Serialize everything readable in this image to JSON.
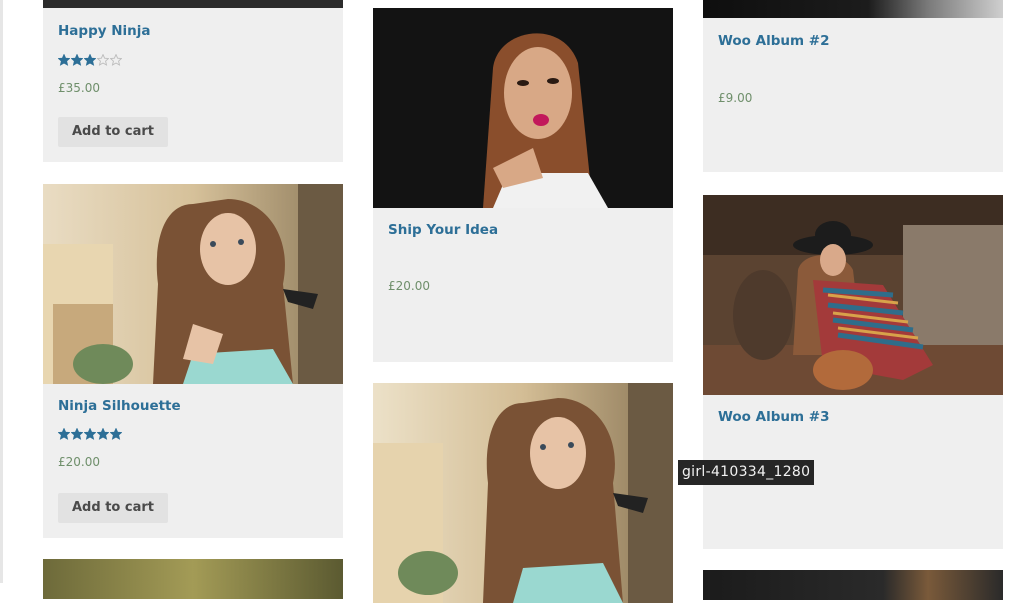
{
  "products": {
    "happy_ninja": {
      "title": "Happy Ninja",
      "rating": 3,
      "rating_max": 5,
      "price": "£35.00",
      "button": "Add to cart"
    },
    "ninja_silhouette": {
      "title": "Ninja Silhouette",
      "rating": 5,
      "rating_max": 5,
      "price": "£20.00",
      "button": "Add to cart"
    },
    "ship_your_idea": {
      "title": "Ship Your Idea",
      "price": "£20.00"
    },
    "woo_album_2": {
      "title": "Woo Album #2",
      "price": "£9.00"
    },
    "woo_album_3": {
      "title": "Woo Album #3"
    }
  },
  "tooltip": {
    "text": "girl-410334_1280"
  },
  "colors": {
    "title": "#2d6f97",
    "price": "#6f8f6b",
    "card_bg": "#efefef",
    "star": "#2d6f97",
    "button_bg": "#e2e2e2"
  }
}
